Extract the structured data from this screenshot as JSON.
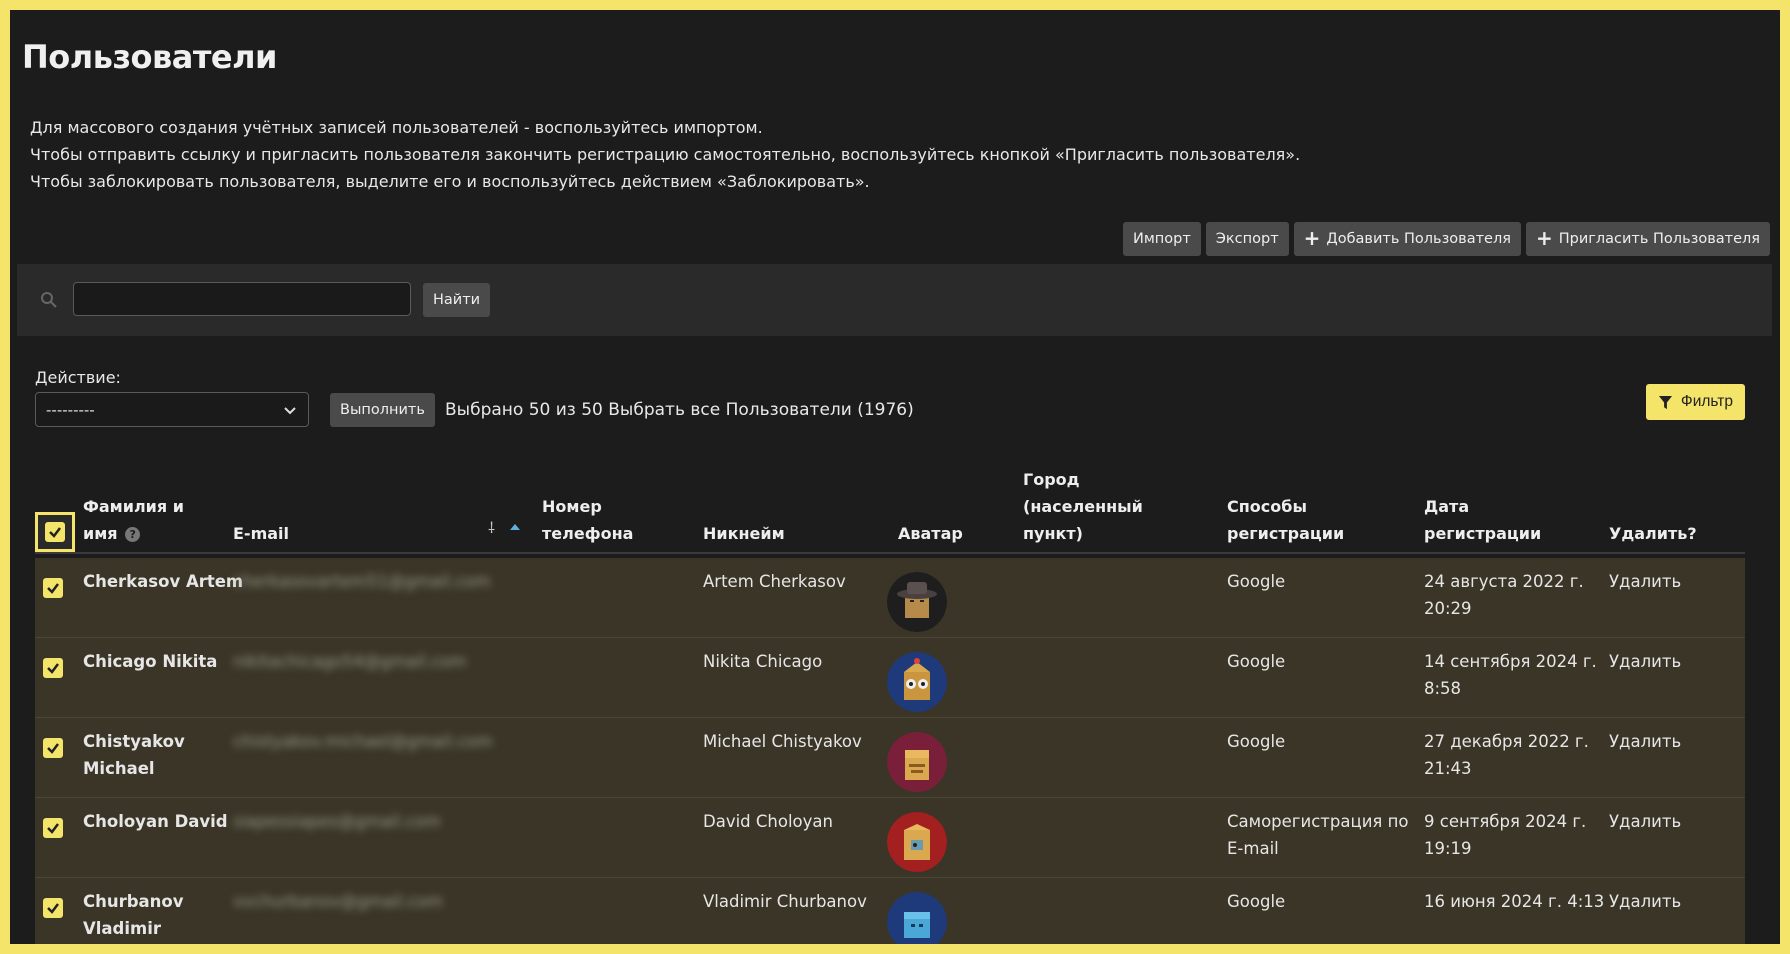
{
  "page": {
    "title": "Пользователи",
    "intro": [
      "Для массового создания учётных записей пользователей - воспользуйтесь импортом.",
      "Чтобы отправить ссылку и пригласить пользователя закончить регистрацию самостоятельно, воспользуйтесь кнопкой «Пригласить пользователя».",
      "Чтобы заблокировать пользователя, выделите его и воспользуйтесь действием «Заблокировать»."
    ]
  },
  "toolbar": {
    "import_label": "Импорт",
    "export_label": "Экспорт",
    "add_user_label": "Добавить Пользователя",
    "invite_user_label": "Пригласить Пользователя"
  },
  "search": {
    "value": "",
    "button_label": "Найти"
  },
  "actions": {
    "label": "Действие:",
    "selected": "---------",
    "run_label": "Выполнить",
    "selection_info": "Выбрано 50 из 50 Выбрать все Пользователи (1976)",
    "filter_label": "Фильтр"
  },
  "table": {
    "headers": {
      "name_1": "Фамилия и",
      "name_2": "имя",
      "email": "E-mail",
      "phone_1": "Номер",
      "phone_2": "телефона",
      "nickname": "Никнейм",
      "avatar": "Аватар",
      "city_1": "Город",
      "city_2": "(населенный",
      "city_3": "пункт)",
      "reg_1": "Способы",
      "reg_2": "регистрации",
      "date_1": "Дата",
      "date_2": "регистрации",
      "delete": "Удалить?"
    },
    "rows": [
      {
        "name_1": "Cherkasov Artem",
        "name_2": "",
        "email": "cherkasovartem51@gmail.com",
        "nickname": "Artem Cherkasov",
        "method_1": "Google",
        "method_2": "",
        "date_1": "24 августа 2022 г.",
        "date_2": "20:29",
        "delete": "Удалить",
        "avatar_bg": "#1e1e1e"
      },
      {
        "name_1": "Chicago Nikita",
        "name_2": "",
        "email": "nikitachicago54@gmail.com",
        "nickname": "Nikita Chicago",
        "method_1": "Google",
        "method_2": "",
        "date_1": "14 сентября 2024 г.",
        "date_2": "8:58",
        "delete": "Удалить",
        "avatar_bg": "#1f3a7a"
      },
      {
        "name_1": "Chistyakov",
        "name_2": "Michael",
        "email": "chistyakov.michael@gmail.com",
        "nickname": "Michael Chistyakov",
        "method_1": "Google",
        "method_2": "",
        "date_1": "27 декабря 2022 г.",
        "date_2": "21:43",
        "delete": "Удалить",
        "avatar_bg": "#7a1f3a"
      },
      {
        "name_1": "Choloyan David",
        "name_2": "",
        "email": "siapessiapes@gmail.com",
        "nickname": "David Choloyan",
        "method_1": "Саморегистрация по",
        "method_2": "E-mail",
        "date_1": "9 сентября 2024 г.",
        "date_2": "19:19",
        "delete": "Удалить",
        "avatar_bg": "#a41f1f"
      },
      {
        "name_1": "Churbanov",
        "name_2": "Vladimir",
        "email": "vvchurbanov@gmail.com",
        "nickname": "Vladimir Churbanov",
        "method_1": "Google",
        "method_2": "",
        "date_1": "16 июня 2024 г. 4:13",
        "date_2": "",
        "delete": "Удалить",
        "avatar_bg": "#1f3a7a"
      }
    ]
  },
  "colors": {
    "accent": "#f5e46a",
    "background": "#1c1c1c",
    "row_selected": "#3a3527",
    "button": "#4a4a4a"
  }
}
